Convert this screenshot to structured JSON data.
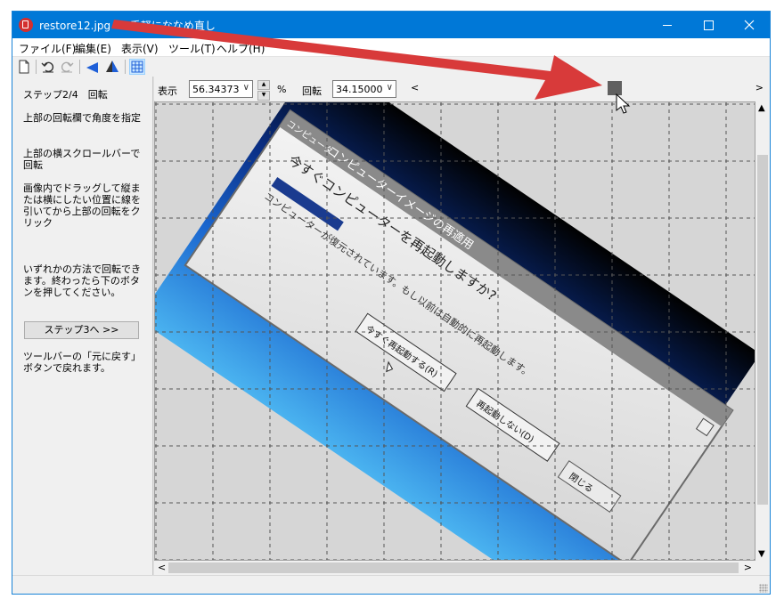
{
  "window": {
    "title": "restore12.jpg * - 手軽にななめ直し"
  },
  "menu": {
    "items": [
      "ファイル(F)",
      "編集(E)",
      "表示(V)",
      "ツール(T)",
      "ヘルプ(H)"
    ]
  },
  "toolbar": {
    "icons": [
      "new-file-icon",
      "undo-icon",
      "redo-icon",
      "flip-horizontal-icon",
      "flip-vertical-icon",
      "grid-icon"
    ]
  },
  "left_panel": {
    "step_title": "ステップ2/4　回転",
    "instr1": "上部の回転欄で角度を指定",
    "instr2": "上部の横スクロールバーで回転",
    "instr3": "画像内でドラッグして縦または横にしたい位置に線を引いてから上部の回転をクリック",
    "instr4": "いずれかの方法で回転できます。終わったら下のボタンを押してください。",
    "next_button": "ステップ3へ >>",
    "tip": "ツールバーの「元に戻す」ボタンで戻れます。"
  },
  "controls": {
    "zoom_label": "表示",
    "zoom_value": "56.343739",
    "percent_label": "%",
    "rotate_label": "回転",
    "rotate_value": "34.150002"
  },
  "scrollbar": {
    "left_arrow": "<",
    "right_arrow": ">",
    "up_arrow": "^",
    "down_arrow": "v"
  },
  "dialog": {
    "banner": "コンピューターイメージの再適用",
    "question": "今すぐコンピューターを再起動しますか?",
    "detail": "コンピューターが復元されています。もし以前は自動的に再起動します。",
    "restart_button": "今すぐ再起動する(R)",
    "no_restart_button": "再起動しない(D)",
    "close_button": "閉じる",
    "tag": "コンピュータ"
  },
  "colors": {
    "titlebar": "#0078d7",
    "arrow": "#d32f2f"
  }
}
